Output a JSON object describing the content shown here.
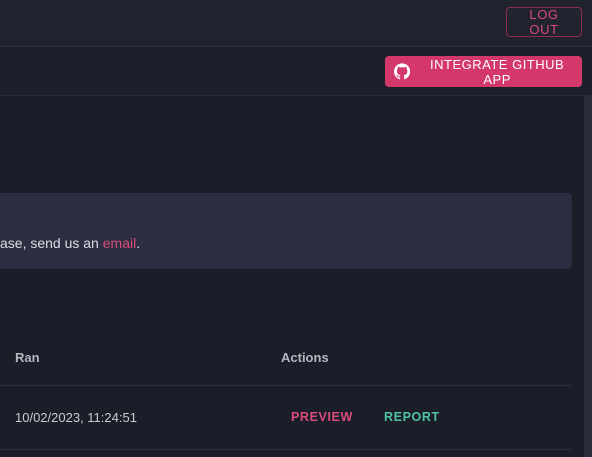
{
  "topbar": {
    "logout_label": "LOG OUT"
  },
  "subbar": {
    "github_button_label": "INTEGRATE GITHUB APP"
  },
  "info": {
    "text_before_link": "ase, send us an ",
    "link_label": "email",
    "text_after_link": "."
  },
  "table": {
    "headers": {
      "ran": "Ran",
      "actions": "Actions"
    },
    "rows": [
      {
        "ran": "10/02/2023, 11:24:51",
        "preview_label": "PREVIEW",
        "report_label": "REPORT"
      }
    ]
  },
  "colors": {
    "accent": "#d4386b",
    "preview": "#d94b7a",
    "report": "#4fc3a1"
  }
}
